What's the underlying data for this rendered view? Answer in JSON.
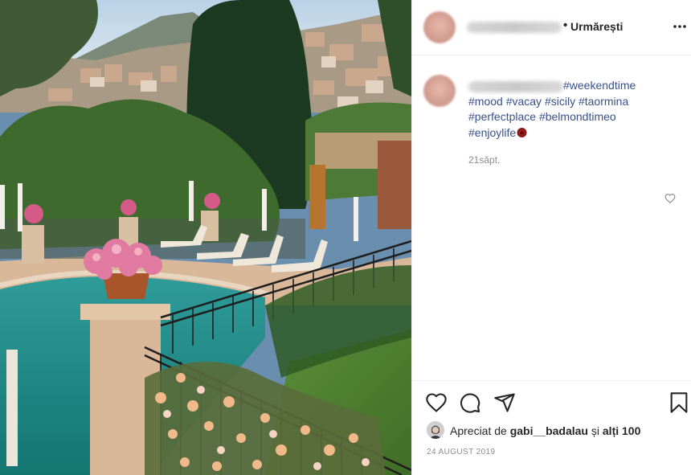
{
  "header": {
    "follow_label": "Urmărești",
    "more_icon": "more-options-icon"
  },
  "caption": {
    "tags": [
      "#weekendtime",
      "#mood",
      "#vacay",
      "#sicily",
      "#taormina",
      "#perfectplace",
      "#belmondtimeo",
      "#enjoylife"
    ],
    "time_ago": "21săpt."
  },
  "actions": {
    "like_icon": "heart-icon",
    "comment_icon": "comment-icon",
    "share_icon": "share-icon",
    "save_icon": "bookmark-icon"
  },
  "likes": {
    "prefix": "Apreciat de",
    "user": "gabi__badalau",
    "conj": "și",
    "others": "alți 100"
  },
  "post_date": "24 AUGUST 2019",
  "colors": {
    "hashtag": "#38518c",
    "meta": "#8e8e8e",
    "text": "#262626"
  }
}
